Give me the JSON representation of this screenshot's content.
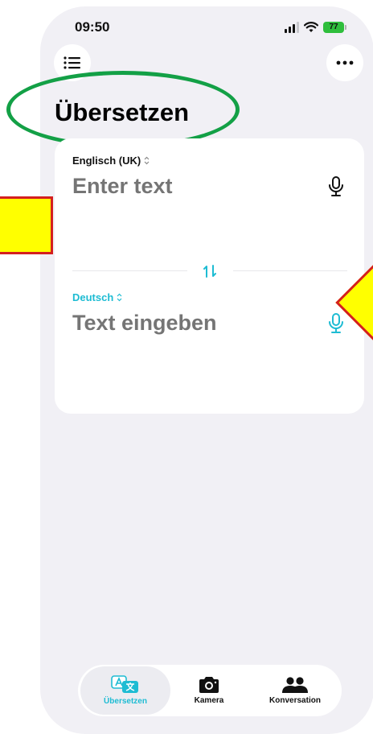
{
  "status_bar": {
    "time": "09:50",
    "battery": "77"
  },
  "header": {
    "title": "Übersetzen"
  },
  "source": {
    "language": "Englisch (UK)",
    "placeholder": "Enter text"
  },
  "target": {
    "language": "Deutsch",
    "placeholder": "Text eingeben"
  },
  "tabs": [
    {
      "label": "Übersetzen",
      "icon": "translate-icon",
      "active": true
    },
    {
      "label": "Kamera",
      "icon": "camera-icon",
      "active": false
    },
    {
      "label": "Konversation",
      "icon": "people-icon",
      "active": false
    }
  ],
  "colors": {
    "accent": "#1ebcd3",
    "background": "#f1f0f5",
    "card": "#ffffff",
    "placeholder_source": "#e0e0e3",
    "placeholder_target": "#bfeef5",
    "annotation_ellipse": "#13a046",
    "annotation_fill": "#ffff00",
    "annotation_border": "#d41f1f"
  },
  "icons": {
    "menu": "list-icon",
    "more": "ellipsis-icon",
    "swap": "swap-arrows-icon",
    "microphone": "microphone-icon",
    "language_selector": "chevron-updown-icon",
    "signal": "signal-bars-icon",
    "wifi": "wifi-icon"
  }
}
